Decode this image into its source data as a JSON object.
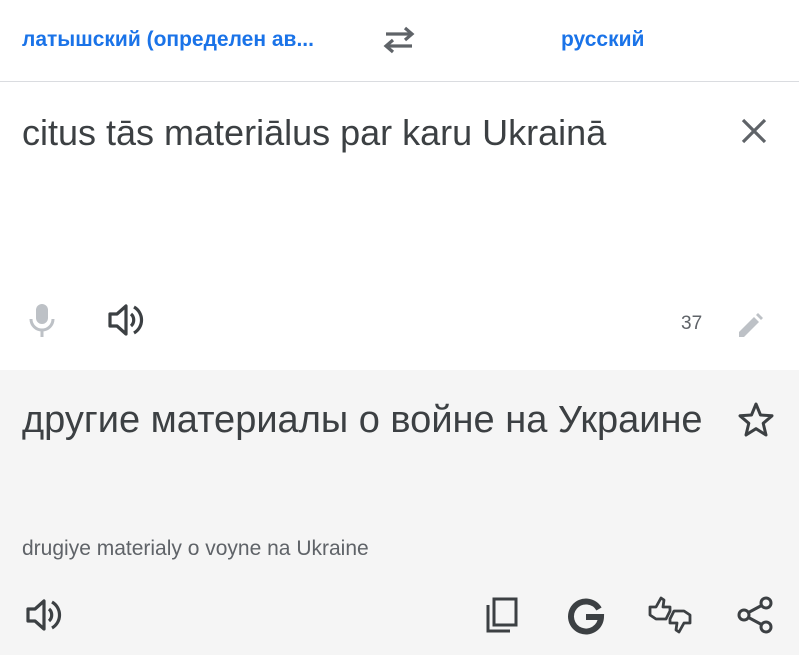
{
  "header": {
    "source_language": "латышский (определен ав...",
    "target_language": "русский",
    "swap_icon": "swap-horiz-icon"
  },
  "source": {
    "text": "citus tās materiālus par karu Ukrainā",
    "char_count": "37",
    "icons": [
      "close-icon",
      "mic-icon",
      "volume-icon",
      "pencil-icon"
    ]
  },
  "result": {
    "text": "другие материалы о войне на Украине",
    "transliteration": "drugiye materialy o voyne na Ukraine",
    "icons": [
      "star-outline-icon",
      "volume-icon",
      "copy-icon",
      "google-icon",
      "feedback-icon",
      "share-icon"
    ]
  },
  "colors": {
    "accent": "#1a73e8",
    "text": "#3c4043",
    "muted": "#5f6368",
    "disabled_icon": "#bdc1c6",
    "result_bg": "#f5f5f5",
    "divider": "#dadce0"
  }
}
